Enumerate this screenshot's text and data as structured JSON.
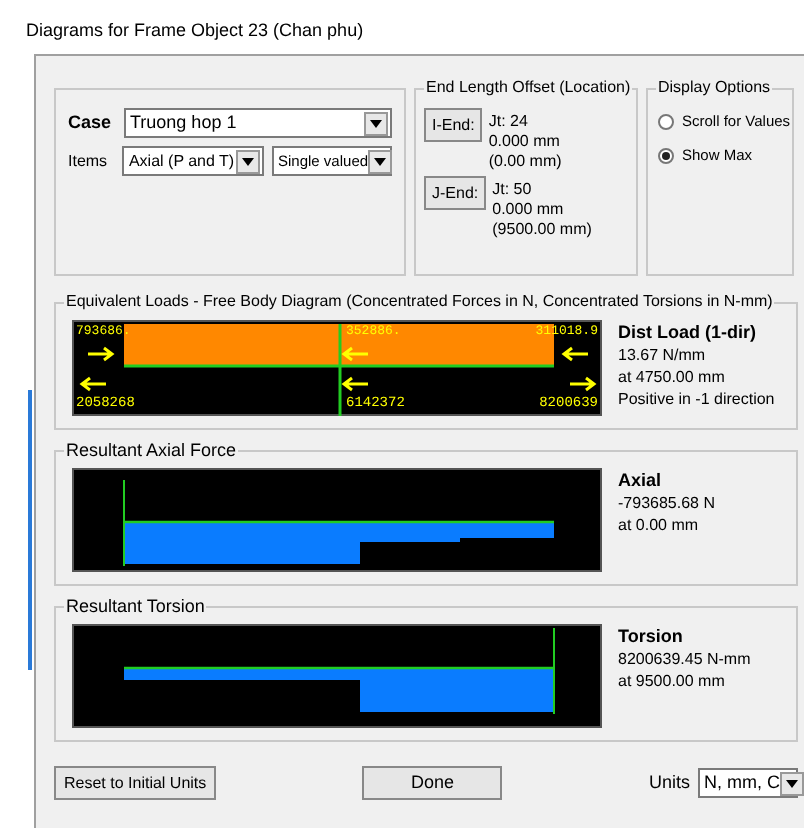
{
  "window": {
    "title": "Diagrams for Frame Object 23  (Chan phu)"
  },
  "case": {
    "label": "Case",
    "value": "Truong hop 1"
  },
  "items": {
    "label": "Items",
    "value": "Axial (P and T)",
    "mode": "Single valued"
  },
  "end_length": {
    "title": "End Length Offset (Location)",
    "ends": [
      {
        "button": "I-End:",
        "joint": "Jt:  24",
        "offset": "0.000 mm",
        "location": "(0.00 mm)"
      },
      {
        "button": "J-End:",
        "joint": "Jt:  50",
        "offset": "0.000 mm",
        "location": "(9500.00 mm)"
      }
    ]
  },
  "display_options": {
    "title": "Display Options",
    "options": [
      {
        "label": "Scroll for Values",
        "selected": false
      },
      {
        "label": "Show Max",
        "selected": true
      }
    ]
  },
  "panels": [
    {
      "kind": "loads",
      "title": "Equivalent Loads - Free Body Diagram  (Concentrated Forces in N, Concentrated Torsions in N-mm)",
      "top_labels": [
        "793686.",
        "352886.",
        "311018.9"
      ],
      "bottom_labels": [
        "2058268",
        "6142372",
        "8200639"
      ],
      "heading": "Dist Load (1-dir)",
      "lines": [
        "13.67 N/mm",
        "at 4750.00 mm",
        "Positive in -1 direction"
      ]
    },
    {
      "kind": "axial",
      "title": "Resultant Axial Force",
      "heading": "Axial",
      "lines": [
        "-793685.68 N",
        "at 0.00 mm"
      ]
    },
    {
      "kind": "torsion",
      "title": "Resultant Torsion",
      "heading": "Torsion",
      "lines": [
        "8200639.45 N-mm",
        "at 9500.00 mm"
      ]
    }
  ],
  "footer": {
    "reset": "Reset to Initial Units",
    "done": "Done",
    "units_label": "Units",
    "units_value": "N, mm, C"
  }
}
